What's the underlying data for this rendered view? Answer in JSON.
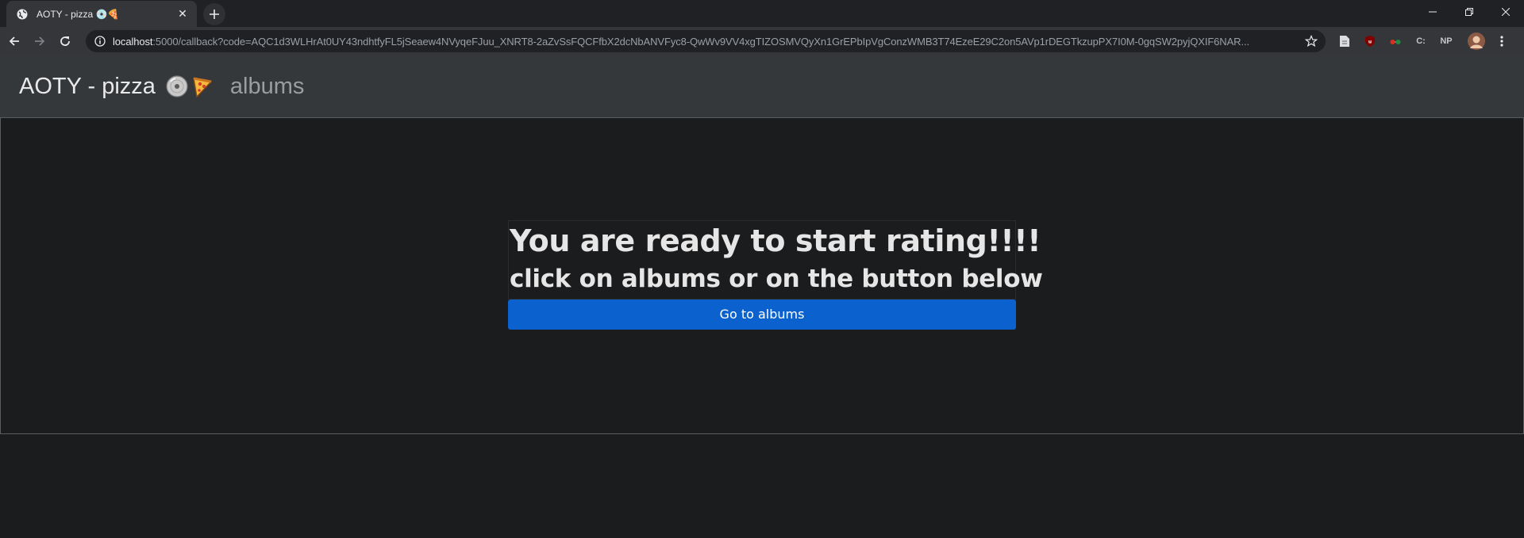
{
  "browser": {
    "tab_title": "AOTY - pizza 💿🍕",
    "tab_close": "✕",
    "url_host": "localhost",
    "url_rest": ":5000/callback?code=AQC1d3WLHrAt0UY43ndhtfyFL5jSeaew4NVyqeFJuu_XNRT8-2aZvSsFQCFfbX2dcNbANVFyc8-QwWv9VV4xgTIZOSMVQyXn1GrEPbIpVgConzWMB3T74EzeE29C2on5AVp1rDEGTkzupPX7I0M-0gqSW2pyjQXIF6NAR...",
    "ext_ct": "C:",
    "ext_np": "NP"
  },
  "navbar": {
    "brand": "AOTY - pizza",
    "albums_link": "albums"
  },
  "main": {
    "heading": "You are ready to start rating!!!!",
    "subheading": "click on albums or on the button below",
    "button_label": "Go to albums"
  },
  "colors": {
    "button": "#0b62cf",
    "navbar": "#35383b",
    "background": "#1b1c1e"
  }
}
